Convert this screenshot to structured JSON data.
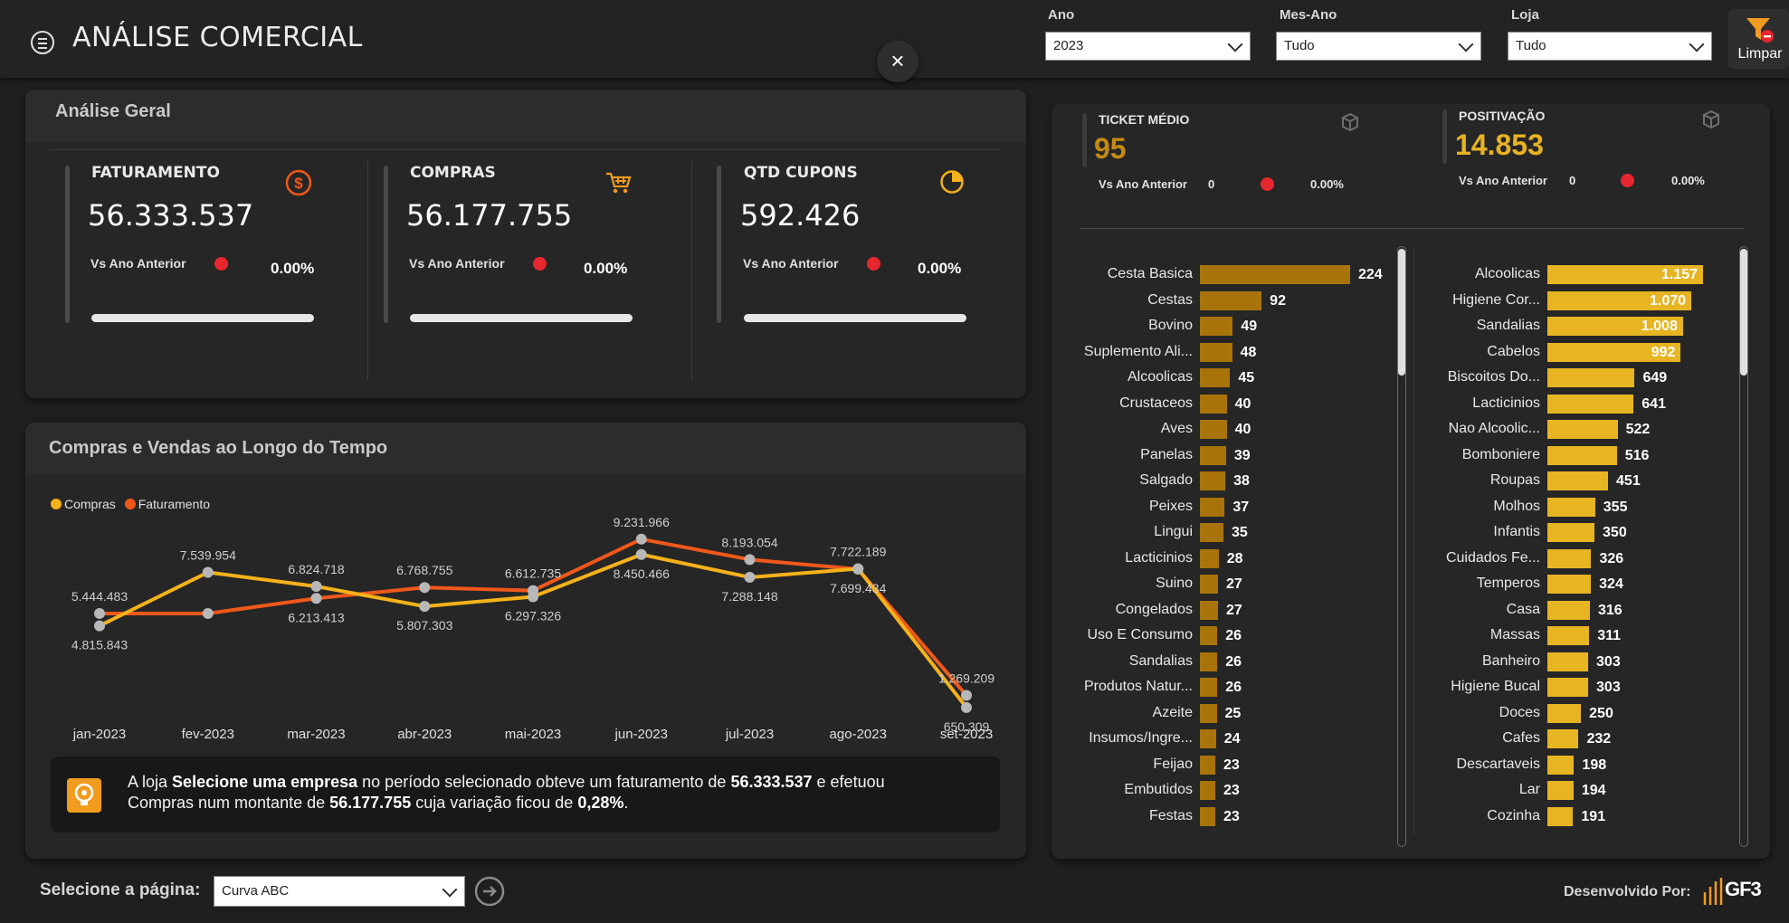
{
  "header": {
    "title": "ANÁLISE COMERCIAL",
    "close_label": "×",
    "filters": [
      {
        "label": "Ano",
        "value": "2023"
      },
      {
        "label": "Mes-Ano",
        "value": "Tudo"
      },
      {
        "label": "Loja",
        "value": "Tudo"
      }
    ],
    "clear_label": "Limpar"
  },
  "overview": {
    "title": "Análise Geral",
    "kpis": [
      {
        "title": "FATURAMENTO",
        "value": "56.333.537",
        "vs_label": "Vs Ano Anterior",
        "pct": "0.00%",
        "icon": "dollar-circle-icon"
      },
      {
        "title": "COMPRAS",
        "value": "56.177.755",
        "vs_label": "Vs Ano Anterior",
        "pct": "0.00%",
        "icon": "shopping-cart-icon"
      },
      {
        "title": "QTD CUPONS",
        "value": "592.426",
        "vs_label": "Vs Ano Anterior",
        "pct": "0.00%",
        "icon": "pie-chart-icon"
      }
    ]
  },
  "timeline": {
    "title": "Compras e Vendas ao Longo do Tempo",
    "legend": [
      {
        "name": "Compras",
        "color": "#f5b21a"
      },
      {
        "name": "Faturamento",
        "color": "#f0581a"
      }
    ]
  },
  "chart_data": {
    "type": "line",
    "categories": [
      "jan-2023",
      "fev-2023",
      "mar-2023",
      "abr-2023",
      "mai-2023",
      "jun-2023",
      "jul-2023",
      "ago-2023",
      "set-2023"
    ],
    "series": [
      {
        "name": "Compras",
        "values": [
          4815843,
          7539954,
          6824718,
          5807303,
          6297326,
          8450466,
          7288148,
          7722189,
          650309
        ],
        "labels": [
          "4.815.843",
          "7.539.954",
          "6.824.718",
          "5.807.303",
          "6.297.326",
          "8.450.466",
          "7.288.148",
          "7.722.189",
          "650.309"
        ]
      },
      {
        "name": "Faturamento",
        "values": [
          5444483,
          5444483,
          6213413,
          6768755,
          6612735,
          9231966,
          8193054,
          7699434,
          1269209
        ],
        "labels": [
          "5.444.483",
          "",
          "6.213.413",
          "6.768.755",
          "6.612.735",
          "9.231.966",
          "8.193.054",
          "7.699.434",
          "1.269.209"
        ]
      }
    ],
    "colors": {
      "Compras": "#f5b21a",
      "Faturamento": "#f0581a"
    }
  },
  "insight": {
    "p1": "A loja ",
    "store": "Selecione uma empresa",
    "p2": " no período selecionado obteve um faturamento de ",
    "faturamento": "56.333.537",
    "p3": " e efetuou",
    "p4": "Compras num montante de ",
    "compras": "56.177.755",
    "p5": " cuja variação ficou de ",
    "variacao": "0,28%",
    "p6": "."
  },
  "ticket": {
    "title": "TICKET MÉDIO",
    "value": "95",
    "vs_label": "Vs Ano Anterior",
    "prev": "0",
    "pct": "0.00%",
    "color": "#c48a12"
  },
  "positivacao": {
    "title": "POSITIVAÇÃO",
    "value": "14.853",
    "vs_label": "Vs Ano Anterior",
    "prev": "0",
    "pct": "0.00%",
    "color": "#e8b322"
  },
  "left_bars": {
    "color": "#a8740a",
    "items": [
      {
        "label": "Cesta Basica",
        "value": 224
      },
      {
        "label": "Cestas",
        "value": 92
      },
      {
        "label": "Bovino",
        "value": 49
      },
      {
        "label": "Suplemento Ali...",
        "value": 48
      },
      {
        "label": "Alcoolicas",
        "value": 45
      },
      {
        "label": "Crustaceos",
        "value": 40
      },
      {
        "label": "Aves",
        "value": 40
      },
      {
        "label": "Panelas",
        "value": 39
      },
      {
        "label": "Salgado",
        "value": 38
      },
      {
        "label": "Peixes",
        "value": 37
      },
      {
        "label": "Lingui",
        "value": 35
      },
      {
        "label": "Lacticinios",
        "value": 28
      },
      {
        "label": "Suino",
        "value": 27
      },
      {
        "label": "Congelados",
        "value": 27
      },
      {
        "label": "Uso E Consumo",
        "value": 26
      },
      {
        "label": "Sandalias",
        "value": 26
      },
      {
        "label": "Produtos Natur...",
        "value": 26
      },
      {
        "label": "Azeite",
        "value": 25
      },
      {
        "label": "Insumos/Ingre...",
        "value": 24
      },
      {
        "label": "Feijao",
        "value": 23
      },
      {
        "label": "Embutidos",
        "value": 23
      },
      {
        "label": "Festas",
        "value": 23
      }
    ]
  },
  "right_bars": {
    "color": "#e7b422",
    "items": [
      {
        "label": "Alcoolicas",
        "value": 1157,
        "text": "1.157"
      },
      {
        "label": "Higiene Cor...",
        "value": 1070,
        "text": "1.070"
      },
      {
        "label": "Sandalias",
        "value": 1008,
        "text": "1.008"
      },
      {
        "label": "Cabelos",
        "value": 992,
        "text": "992"
      },
      {
        "label": "Biscoitos Do...",
        "value": 649,
        "text": "649"
      },
      {
        "label": "Lacticinios",
        "value": 641,
        "text": "641"
      },
      {
        "label": "Nao Alcoolic...",
        "value": 522,
        "text": "522"
      },
      {
        "label": "Bomboniere",
        "value": 516,
        "text": "516"
      },
      {
        "label": "Roupas",
        "value": 451,
        "text": "451"
      },
      {
        "label": "Molhos",
        "value": 355,
        "text": "355"
      },
      {
        "label": "Infantis",
        "value": 350,
        "text": "350"
      },
      {
        "label": "Cuidados Fe...",
        "value": 326,
        "text": "326"
      },
      {
        "label": "Temperos",
        "value": 324,
        "text": "324"
      },
      {
        "label": "Casa",
        "value": 316,
        "text": "316"
      },
      {
        "label": "Massas",
        "value": 311,
        "text": "311"
      },
      {
        "label": "Banheiro",
        "value": 303,
        "text": "303"
      },
      {
        "label": "Higiene Bucal",
        "value": 303,
        "text": "303"
      },
      {
        "label": "Doces",
        "value": 250,
        "text": "250"
      },
      {
        "label": "Cafes",
        "value": 232,
        "text": "232"
      },
      {
        "label": "Descartaveis",
        "value": 198,
        "text": "198"
      },
      {
        "label": "Lar",
        "value": 194,
        "text": "194"
      },
      {
        "label": "Cozinha",
        "value": 191,
        "text": "191"
      }
    ]
  },
  "footer": {
    "page_label": "Selecione a página:",
    "page_value": "Curva ABC",
    "dev_label": "Desenvolvido Por:",
    "logo_text": "GF3"
  }
}
